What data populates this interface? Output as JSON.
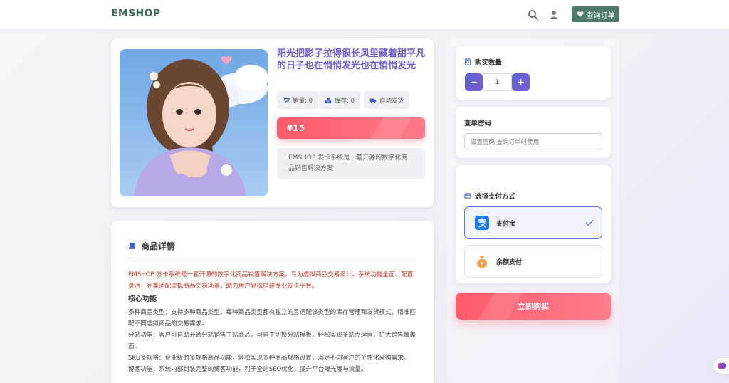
{
  "header": {
    "brand": "EMSHOP",
    "order_query_label": "查询订单",
    "icons": [
      "search-icon",
      "user-icon",
      "heart-icon"
    ]
  },
  "product": {
    "title": "阳光把影子拉得很长风里藏着甜平凡的日子也在悄悄发光也在悄悄发光",
    "sales": "销量: 0",
    "stock": "库存: 0",
    "delivery": "自动发货",
    "price": "¥15",
    "short_desc": "EMSHOP 发卡系统是一套开源的数字化商品销售解决方案"
  },
  "details": {
    "heading": "商品详情",
    "intro": "EMSHOP 发卡系统是一套开源的数字化商品销售解决方案，专为虚拟商品交易设计。系统功能全面、配置灵活，完美适配虚拟商品交易场景，助力用户轻松搭建专业发卡平台。",
    "core_heading": "核心功能",
    "lines": [
      "多种商品类型：支持多种商品类型，每种商品类型都有独立的且适配该类型的库存管理和发货模式，精准匹配不同虚拟商品的交易需求。",
      "分站功能：客户可自助开通分站销售主站商品，可自主切换分站模板，轻松实现多站点运营，扩大销售覆盖面。",
      "SKU多规格：企业级的多规格商品功能，轻松实现多种商品规格设置，满足不同客户的个性化采购需求。",
      "博客功能：系统内部封装完整的博客功能，利于全站SEO优化，提升平台曝光度与流量。"
    ]
  },
  "purchase": {
    "qty_label": "购买数量",
    "qty_value": "1",
    "minus": "−",
    "plus": "+",
    "pwd_label": "查单密码",
    "pwd_placeholder": "设置密码 查询订单时使用",
    "pay_label": "选择支付方式",
    "methods": [
      {
        "name": "支付宝",
        "selected": true
      },
      {
        "name": "余额支付",
        "selected": false
      }
    ],
    "buy_label": "立即购买"
  },
  "colors": {
    "brand": "#3f6b5c",
    "title": "#6a5acd",
    "price": "#ff5a6a",
    "accent": "#5b63d6"
  }
}
